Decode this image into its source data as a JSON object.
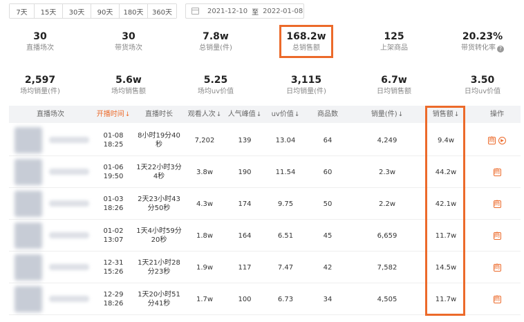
{
  "filters": {
    "ranges": [
      "7天",
      "15天",
      "30天",
      "90天",
      "180天",
      "360天"
    ],
    "date_start": "2021-12-10",
    "date_separator": "至",
    "date_end": "2022-01-08"
  },
  "stats_row1": [
    {
      "value": "30",
      "label": "直播场次"
    },
    {
      "value": "30",
      "label": "带货场次"
    },
    {
      "value": "7.8w",
      "label": "总销量(件)"
    },
    {
      "value": "168.2w",
      "label": "总销售额"
    },
    {
      "value": "125",
      "label": "上架商品"
    },
    {
      "value": "20.23%",
      "label": "带货转化率"
    }
  ],
  "stats_row2": [
    {
      "value": "2,597",
      "label": "场均销量(件)"
    },
    {
      "value": "5.6w",
      "label": "场均销售额"
    },
    {
      "value": "5.25",
      "label": "场均uv价值"
    },
    {
      "value": "3,115",
      "label": "日均销量(件)"
    },
    {
      "value": "6.7w",
      "label": "日均销售额"
    },
    {
      "value": "3.50",
      "label": "日均uv价值"
    }
  ],
  "table": {
    "headers": {
      "session": "直播场次",
      "start_time": "开播时间",
      "duration": "直播时长",
      "viewers": "观看人次",
      "peak": "人气峰值",
      "uv_value": "uv价值",
      "goods": "商品数",
      "sales_qty": "销量(件)",
      "sales_amount": "销售额",
      "action": "操作"
    },
    "sort_arrow": "↓",
    "rows": [
      {
        "date": "01-08",
        "time": "18:25",
        "duration_l1": "8小时19分40",
        "duration_l2": "秒",
        "viewers": "7,202",
        "peak": "139",
        "uv": "13.04",
        "goods": "64",
        "qty": "4,249",
        "amount": "9.4w"
      },
      {
        "date": "01-06",
        "time": "19:50",
        "duration_l1": "1天22小时3分",
        "duration_l2": "4秒",
        "viewers": "3.8w",
        "peak": "190",
        "uv": "11.54",
        "goods": "60",
        "qty": "2.3w",
        "amount": "44.2w"
      },
      {
        "date": "01-03",
        "time": "18:26",
        "duration_l1": "2天23小时43",
        "duration_l2": "分50秒",
        "viewers": "4.3w",
        "peak": "174",
        "uv": "9.75",
        "goods": "50",
        "qty": "2.2w",
        "amount": "42.1w"
      },
      {
        "date": "01-02",
        "time": "13:07",
        "duration_l1": "1天4小时59分",
        "duration_l2": "20秒",
        "viewers": "1.8w",
        "peak": "164",
        "uv": "6.51",
        "goods": "45",
        "qty": "6,659",
        "amount": "11.7w"
      },
      {
        "date": "12-31",
        "time": "15:26",
        "duration_l1": "1天21小时28",
        "duration_l2": "分23秒",
        "viewers": "1.9w",
        "peak": "117",
        "uv": "7.47",
        "goods": "42",
        "qty": "7,582",
        "amount": "14.5w"
      },
      {
        "date": "12-29",
        "time": "18:26",
        "duration_l1": "1天20小时51",
        "duration_l2": "分41秒",
        "viewers": "1.7w",
        "peak": "100",
        "uv": "6.73",
        "goods": "34",
        "qty": "4,505",
        "amount": "11.7w"
      }
    ]
  },
  "icons": {
    "detail": "商",
    "play": "▶"
  },
  "colors": {
    "accent": "#ec6a2a",
    "header_bg": "#f2f3f5"
  }
}
